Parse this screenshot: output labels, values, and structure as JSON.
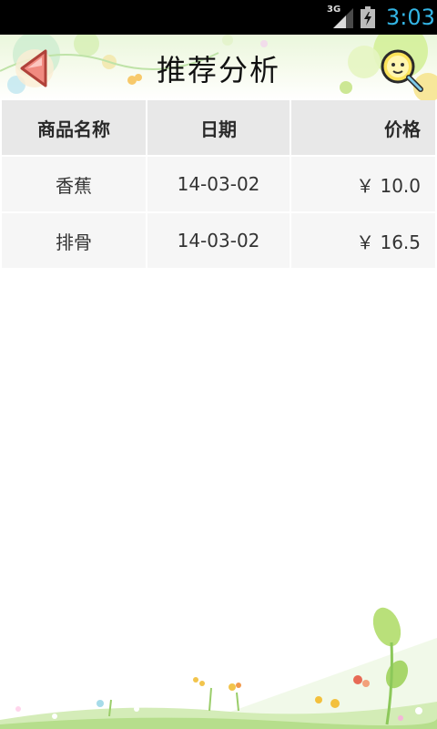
{
  "status_bar": {
    "network": "3G",
    "time": "3:03",
    "time_color": "#33b5e5"
  },
  "header": {
    "title": "推荐分析",
    "back_icon": "back-arrow-icon",
    "search_icon": "search-icon"
  },
  "table": {
    "columns": [
      "商品名称",
      "日期",
      "价格"
    ],
    "rows": [
      [
        "香蕉",
        "14-03-02",
        "￥ 10.0"
      ],
      [
        "排骨",
        "14-03-02",
        "￥ 16.5"
      ]
    ]
  },
  "colors": {
    "header_cell_bg": "#e8e8e8",
    "data_cell_bg": "#f6f6f6",
    "status_bar_bg": "#000000"
  }
}
